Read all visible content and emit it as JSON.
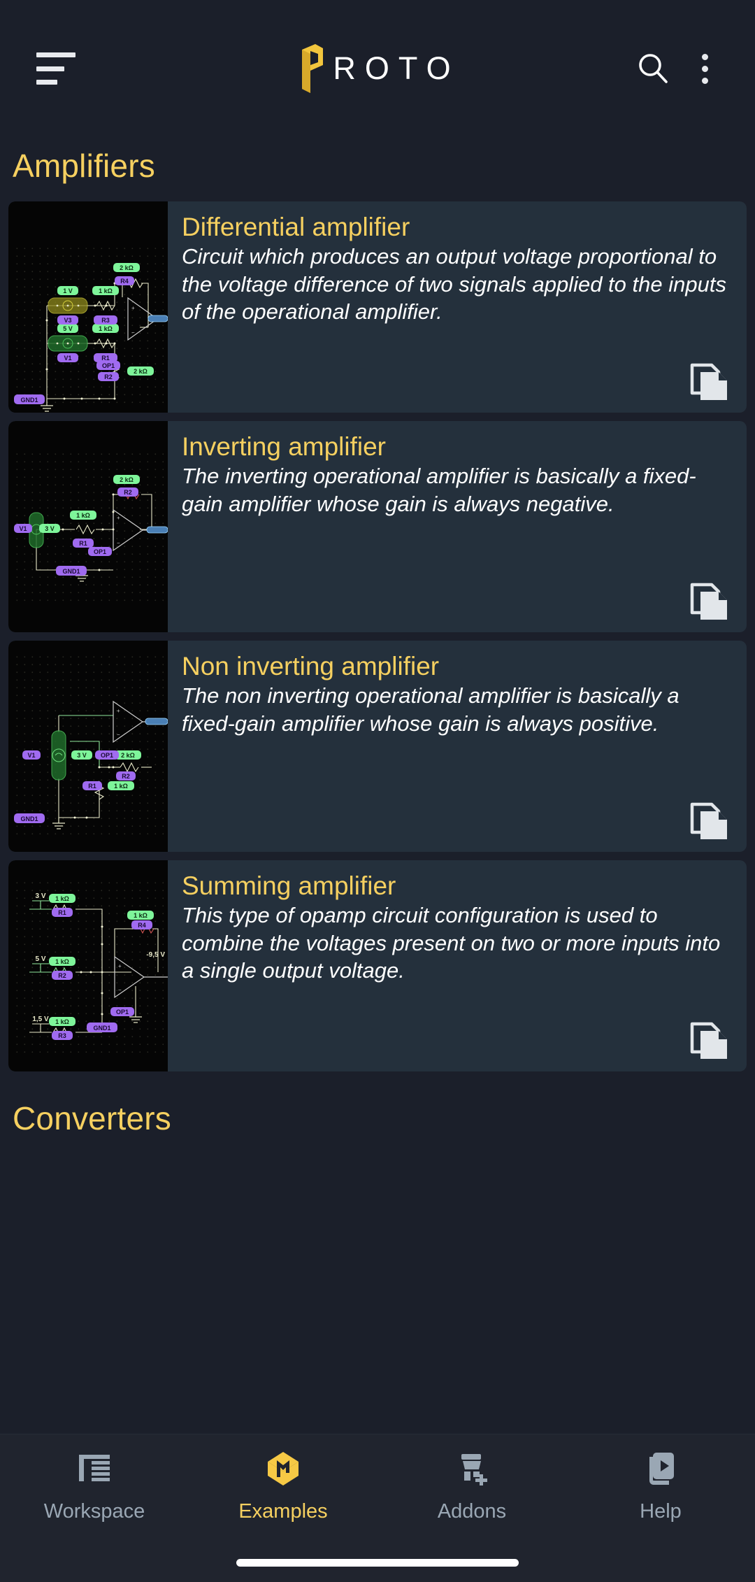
{
  "app": {
    "brand_name": "ROTO",
    "brand_color": "#f6d060",
    "accent_color": "#f6d060",
    "background": "#1b1f2a",
    "card_background": "#24303c"
  },
  "appbar": {
    "menu_icon": "hamburger-menu-icon",
    "logo_icon": "proto-p-logo-icon",
    "search_icon": "search-icon",
    "overflow_icon": "more-vertical-icon"
  },
  "sections": [
    {
      "id": "amplifiers",
      "title": "Amplifiers"
    },
    {
      "id": "converters",
      "title": "Converters"
    }
  ],
  "cards": [
    {
      "title": "Differential amplifier",
      "description": "Circuit which produces an output voltage proportional to the voltage difference of two signals applied to the inputs of the operational amplifier.",
      "copy_icon": "copy-icon",
      "circuit": {
        "sources": [
          {
            "ref": "V3",
            "value": "1 V"
          },
          {
            "ref": "V1",
            "value": "5 V"
          }
        ],
        "resistors": [
          {
            "ref": "R3",
            "value": "1 kΩ"
          },
          {
            "ref": "R1",
            "value": "1 kΩ"
          },
          {
            "ref": "R4",
            "value": "2 kΩ"
          },
          {
            "ref": "R2",
            "value": "2 kΩ"
          }
        ],
        "opamps": [
          {
            "ref": "OP1"
          }
        ],
        "grounds": [
          {
            "ref": "GND1"
          }
        ]
      }
    },
    {
      "title": "Inverting amplifier",
      "description": "The inverting operational amplifier is basically a fixed-gain amplifier whose gain is always negative.",
      "copy_icon": "copy-icon",
      "circuit": {
        "sources": [
          {
            "ref": "V1",
            "value": "3 V"
          }
        ],
        "resistors": [
          {
            "ref": "R1",
            "value": "1 kΩ"
          },
          {
            "ref": "R2",
            "value": "2 kΩ"
          }
        ],
        "opamps": [
          {
            "ref": "OP1"
          }
        ],
        "grounds": [
          {
            "ref": "GND1"
          }
        ]
      }
    },
    {
      "title": "Non inverting amplifier",
      "description": "The non inverting operational amplifier is basically a fixed-gain amplifier whose gain is always positive.",
      "copy_icon": "copy-icon",
      "circuit": {
        "sources": [
          {
            "ref": "V1",
            "value": "3 V"
          }
        ],
        "resistors": [
          {
            "ref": "R1",
            "value": "1 kΩ"
          },
          {
            "ref": "R2",
            "value": "2 kΩ"
          }
        ],
        "opamps": [
          {
            "ref": "OP1"
          }
        ],
        "grounds": [
          {
            "ref": "GND1"
          }
        ]
      }
    },
    {
      "title": "Summing amplifier",
      "description": "This type of opamp circuit configuration is used to combine the voltages present on two or more inputs into a single output voltage.",
      "copy_icon": "copy-icon",
      "circuit": {
        "sources": [
          {
            "ref": "",
            "value": "3 V"
          },
          {
            "ref": "",
            "value": "5 V"
          },
          {
            "ref": "",
            "value": "1,5 V"
          }
        ],
        "resistors": [
          {
            "ref": "R1",
            "value": "1 kΩ"
          },
          {
            "ref": "R2",
            "value": "1 kΩ"
          },
          {
            "ref": "R3",
            "value": "1 kΩ"
          },
          {
            "ref": "R4",
            "value": "1 kΩ"
          }
        ],
        "opamps": [
          {
            "ref": "OP1"
          }
        ],
        "grounds": [
          {
            "ref": "GND1"
          }
        ],
        "probes": [
          {
            "value": "-9,5 V"
          }
        ]
      }
    }
  ],
  "bottom_nav": {
    "items": [
      {
        "label": "Workspace",
        "icon": "workspace-panels-icon",
        "active": false
      },
      {
        "label": "Examples",
        "icon": "examples-cube-icon",
        "active": true
      },
      {
        "label": "Addons",
        "icon": "addons-plus-icon",
        "active": false
      },
      {
        "label": "Help",
        "icon": "help-play-book-icon",
        "active": false
      }
    ]
  }
}
